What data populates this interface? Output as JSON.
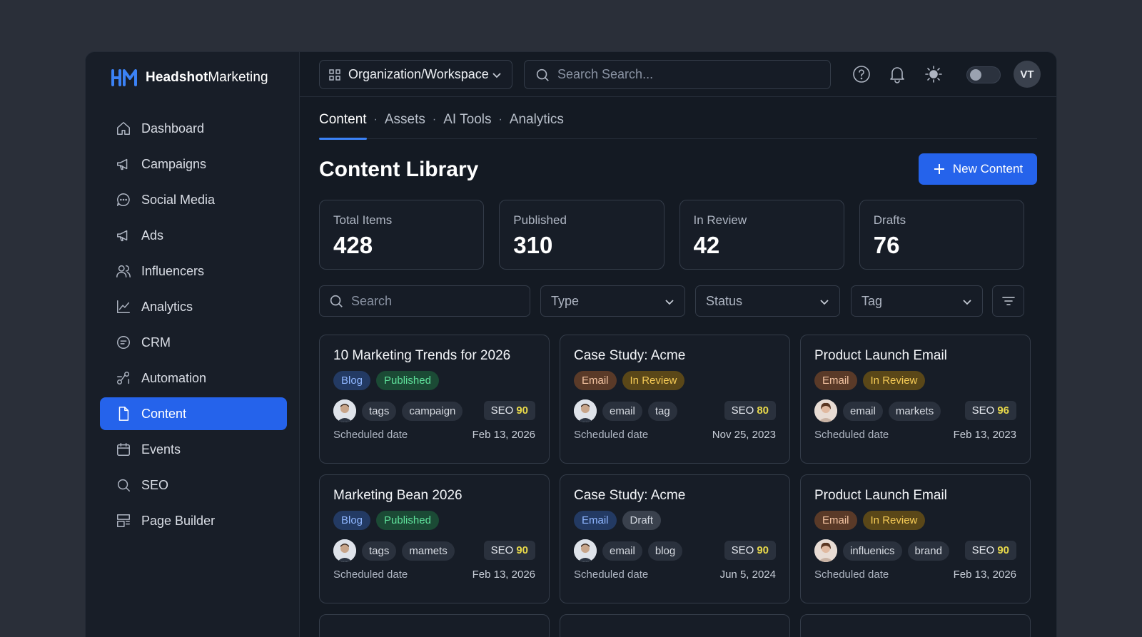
{
  "brand": {
    "name_bold": "Headshot",
    "name_regular": "Marketing"
  },
  "sidebar": {
    "items": [
      {
        "label": "Dashboard",
        "icon": "home-icon"
      },
      {
        "label": "Campaigns",
        "icon": "megaphone-icon"
      },
      {
        "label": "Social Media",
        "icon": "chat-icon"
      },
      {
        "label": "Ads",
        "icon": "megaphone-icon"
      },
      {
        "label": "Influencers",
        "icon": "users-icon"
      },
      {
        "label": "Analytics",
        "icon": "chart-icon"
      },
      {
        "label": "CRM",
        "icon": "crm-icon"
      },
      {
        "label": "Automation",
        "icon": "automation-icon"
      },
      {
        "label": "Content",
        "icon": "document-icon",
        "active": true
      },
      {
        "label": "Events",
        "icon": "calendar-icon"
      },
      {
        "label": "SEO",
        "icon": "search-icon"
      },
      {
        "label": "Page Builder",
        "icon": "layout-icon"
      }
    ]
  },
  "topbar": {
    "workspace": "Organization/Workspace",
    "search_placeholder": "Search Search...",
    "avatar_initials": "VT"
  },
  "tabs": [
    {
      "label": "Content",
      "active": true
    },
    {
      "label": "Assets"
    },
    {
      "label": "AI Tools"
    },
    {
      "label": "Analytics"
    }
  ],
  "page": {
    "title": "Content Library",
    "new_button": "New Content"
  },
  "stats": [
    {
      "label": "Total Items",
      "value": "428"
    },
    {
      "label": "Published",
      "value": "310"
    },
    {
      "label": "In Review",
      "value": "42"
    },
    {
      "label": "Drafts",
      "value": "76"
    }
  ],
  "filters": {
    "search_placeholder": "Search",
    "type": "Type",
    "status": "Status",
    "tag": "Tag"
  },
  "cards": [
    {
      "title": "10 Marketing Trends for 2026",
      "type": "Blog",
      "status": "Published",
      "tags": [
        "tags",
        "campaign"
      ],
      "seo_label": "SEO",
      "seo": "90",
      "date_label": "Scheduled date",
      "date": "Feb 13, 2026"
    },
    {
      "title": "Case Study: Acme",
      "type": "Email",
      "status": "In Review",
      "tags": [
        "email",
        "tag"
      ],
      "seo_label": "SEO",
      "seo": "80",
      "date_label": "Scheduled date",
      "date": "Nov 25, 2023"
    },
    {
      "title": "Product Launch Email",
      "type": "Email",
      "status": "In Review",
      "tags": [
        "email",
        "markets"
      ],
      "seo_label": "SEO",
      "seo": "96",
      "date_label": "Scheduled date",
      "date": "Feb 13, 2023"
    },
    {
      "title": "Marketing Bean 2026",
      "type": "Blog",
      "status": "Published",
      "tags": [
        "tags",
        "mamets"
      ],
      "seo_label": "SEO",
      "seo": "90",
      "date_label": "Scheduled date",
      "date": "Feb 13, 2026"
    },
    {
      "title": "Case Study: Acme",
      "type": "Email",
      "status": "Draft",
      "tags": [
        "email",
        "blog"
      ],
      "seo_label": "SEO",
      "seo": "90",
      "date_label": "Scheduled date",
      "date": "Jun 5, 2024"
    },
    {
      "title": "Product Launch Email",
      "type": "Email",
      "status": "In Review",
      "tags": [
        "influenics",
        "brand"
      ],
      "seo_label": "SEO",
      "seo": "90",
      "date_label": "Scheduled date",
      "date": "Feb 13, 2026"
    }
  ],
  "colors": {
    "accent": "#2563eb",
    "published": "#5fe19b",
    "in_review": "#f6cb56",
    "seo_score": "#e7d84a"
  }
}
